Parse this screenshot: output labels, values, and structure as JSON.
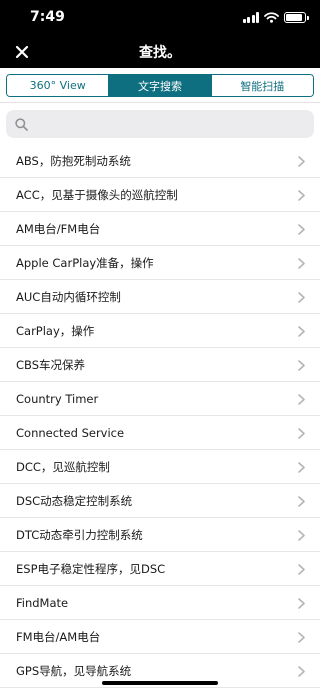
{
  "status_bar": {
    "time": "7:49",
    "icons": [
      "signal-icon",
      "wifi-icon",
      "battery-icon"
    ]
  },
  "header": {
    "title": "查找。",
    "close_icon": "close-icon"
  },
  "tabs": [
    {
      "label": "360° View",
      "active": false
    },
    {
      "label": "文字搜索",
      "active": true
    },
    {
      "label": "智能扫描",
      "active": false
    }
  ],
  "search": {
    "placeholder": "",
    "value": "",
    "icon": "search-icon"
  },
  "list": {
    "items": [
      {
        "label": "ABS，防抱死制动系统"
      },
      {
        "label": "ACC，见基于摄像头的巡航控制"
      },
      {
        "label": "AM电台/FM电台"
      },
      {
        "label": "Apple CarPlay准备，操作"
      },
      {
        "label": "AUC自动内循环控制"
      },
      {
        "label": "CarPlay，操作"
      },
      {
        "label": "CBS车况保养"
      },
      {
        "label": "Country Timer"
      },
      {
        "label": "Connected Service"
      },
      {
        "label": "DCC，见巡航控制"
      },
      {
        "label": "DSC动态稳定控制系统"
      },
      {
        "label": "DTC动态牵引力控制系统"
      },
      {
        "label": "ESP电子稳定性程序，见DSC"
      },
      {
        "label": "FindMate"
      },
      {
        "label": "FM电台/AM电台"
      },
      {
        "label": "GPS导航，见导航系统"
      }
    ],
    "row_icon": "chevron-right-icon"
  },
  "colors": {
    "accent": "#0e6f80",
    "header_bg": "#000000",
    "search_bg": "#ececee",
    "divider": "#e6e6e6",
    "chevron": "#b5b5b5"
  }
}
